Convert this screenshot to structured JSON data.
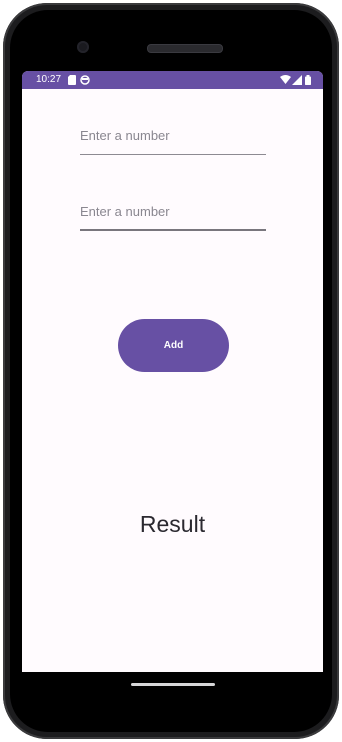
{
  "status_bar": {
    "time": "10:27",
    "background": "#6750a4",
    "left_icons": [
      "sd-card-icon",
      "sync-circle-icon"
    ],
    "right_icons": [
      "wifi-icon",
      "cell-signal-icon",
      "battery-icon"
    ]
  },
  "form": {
    "first_number_placeholder": "Enter a number",
    "first_number_value": "",
    "second_number_placeholder": "Enter a number",
    "second_number_value": ""
  },
  "add_button": {
    "label": "Add",
    "color": "#6750a4"
  },
  "result": {
    "text": "Result"
  }
}
